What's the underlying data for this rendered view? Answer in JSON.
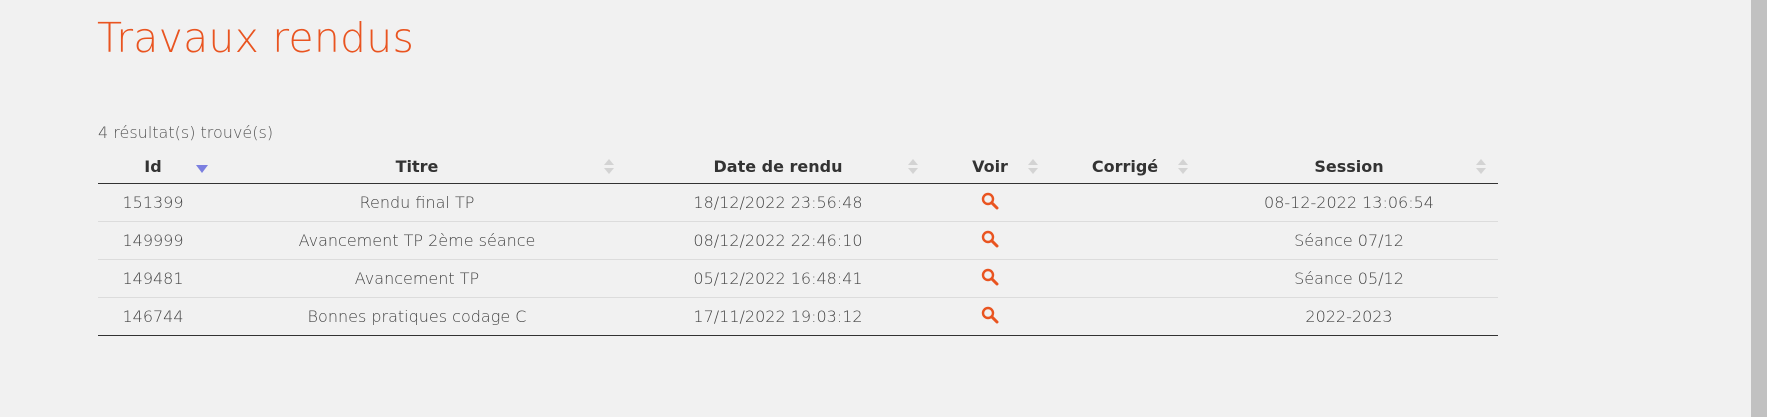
{
  "page": {
    "title": "Travaux rendus",
    "result_count": "4 résultat(s) trouvé(s)"
  },
  "colors": {
    "accent": "#e95420",
    "sort_active": "#7b7fe0",
    "sort_inactive": "#d3d3d3",
    "background": "#f1f1f1"
  },
  "table": {
    "columns": [
      "Id",
      "Titre",
      "Date de rendu",
      "Voir",
      "Corrigé",
      "Session"
    ],
    "sorted_column": "Id",
    "sort_direction": "descending",
    "rows": [
      {
        "id": "151399",
        "titre": "Rendu final TP",
        "date": "18/12/2022 23:56:48",
        "voir_icon": "search-icon",
        "corrige": "",
        "session": "08-12-2022 13:06:54"
      },
      {
        "id": "149999",
        "titre": "Avancement TP 2ème séance",
        "date": "08/12/2022 22:46:10",
        "voir_icon": "search-icon",
        "corrige": "",
        "session": "Séance 07/12"
      },
      {
        "id": "149481",
        "titre": "Avancement TP",
        "date": "05/12/2022 16:48:41",
        "voir_icon": "search-icon",
        "corrige": "",
        "session": "Séance 05/12"
      },
      {
        "id": "146744",
        "titre": "Bonnes pratiques codage C",
        "date": "17/11/2022 19:03:12",
        "voir_icon": "search-icon",
        "corrige": "",
        "session": "2022-2023"
      }
    ]
  }
}
